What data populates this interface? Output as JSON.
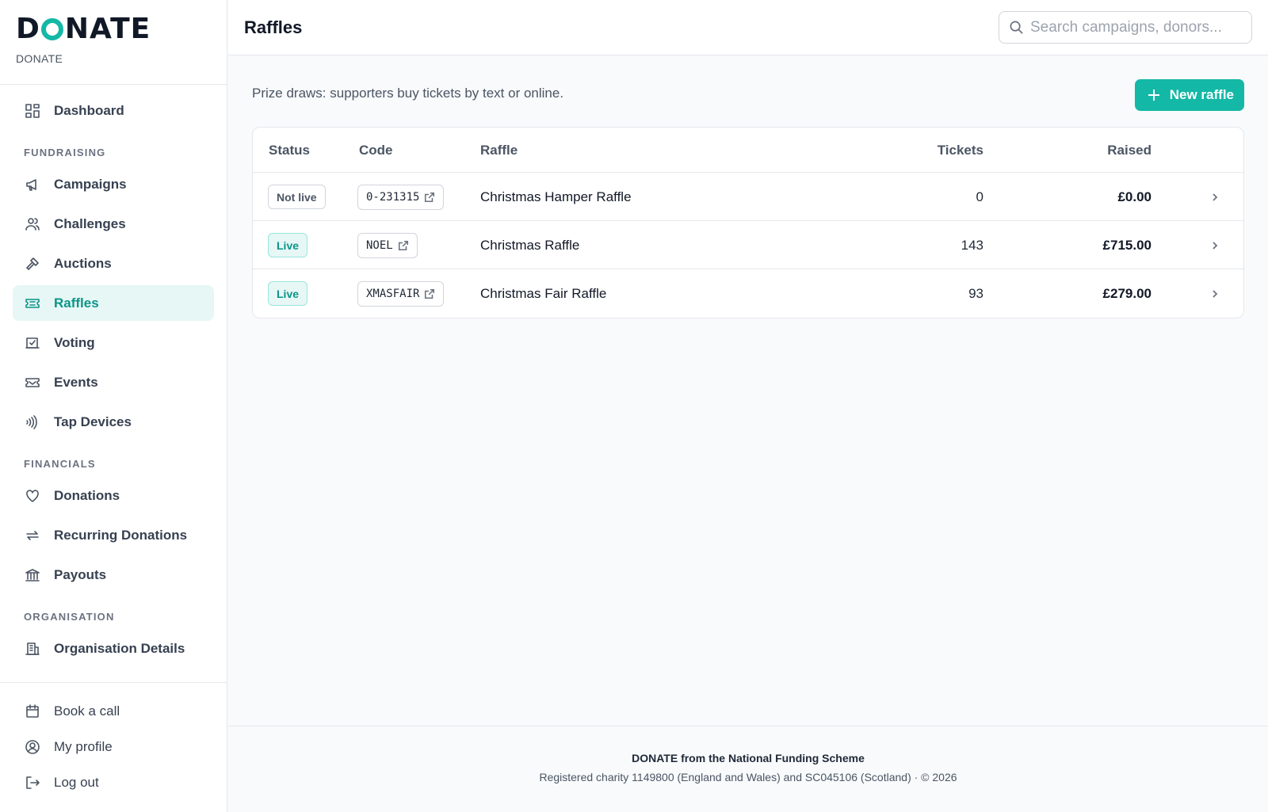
{
  "brand": {
    "logo": "DONATE",
    "subtitle": "DONATE"
  },
  "nav": {
    "dashboard": "Dashboard",
    "fundraising_label": "FUNDRAISING",
    "campaigns": "Campaigns",
    "challenges": "Challenges",
    "auctions": "Auctions",
    "raffles": "Raffles",
    "voting": "Voting",
    "events": "Events",
    "tap_devices": "Tap Devices",
    "financials_label": "FINANCIALS",
    "donations": "Donations",
    "recurring_donations": "Recurring Donations",
    "payouts": "Payouts",
    "organisation_label": "ORGANISATION",
    "organisation_details": "Organisation Details",
    "active": "raffles"
  },
  "bottom_nav": {
    "book_call": "Book a call",
    "profile": "My profile",
    "logout": "Log out"
  },
  "header": {
    "title": "Raffles",
    "search_placeholder": "Search campaigns, donors..."
  },
  "main": {
    "intro": "Prize draws: supporters buy tickets by text or online.",
    "new_button": "New raffle"
  },
  "table": {
    "columns": {
      "status": "Status",
      "code": "Code",
      "raffle": "Raffle",
      "tickets": "Tickets",
      "raised": "Raised"
    },
    "rows": [
      {
        "status": "Not live",
        "code": "0-231315",
        "name": "Christmas Hamper Raffle",
        "tickets": "0",
        "raised": "£0.00"
      },
      {
        "status": "Live",
        "code": "NOEL",
        "name": "Christmas Raffle",
        "tickets": "143",
        "raised": "£715.00"
      },
      {
        "status": "Live",
        "code": "XMASFAIR",
        "name": "Christmas Fair Raffle",
        "tickets": "93",
        "raised": "£279.00"
      }
    ]
  },
  "footer": {
    "title": "DONATE from the National Funding Scheme",
    "subtitle": "Registered charity 1149800 (England and Wales) and SC045106 (Scotland)  ·  © 2026"
  },
  "colors": {
    "accent": "#14b8a6",
    "accent_dark": "#0d9488",
    "active_bg": "#e6f7f5"
  }
}
